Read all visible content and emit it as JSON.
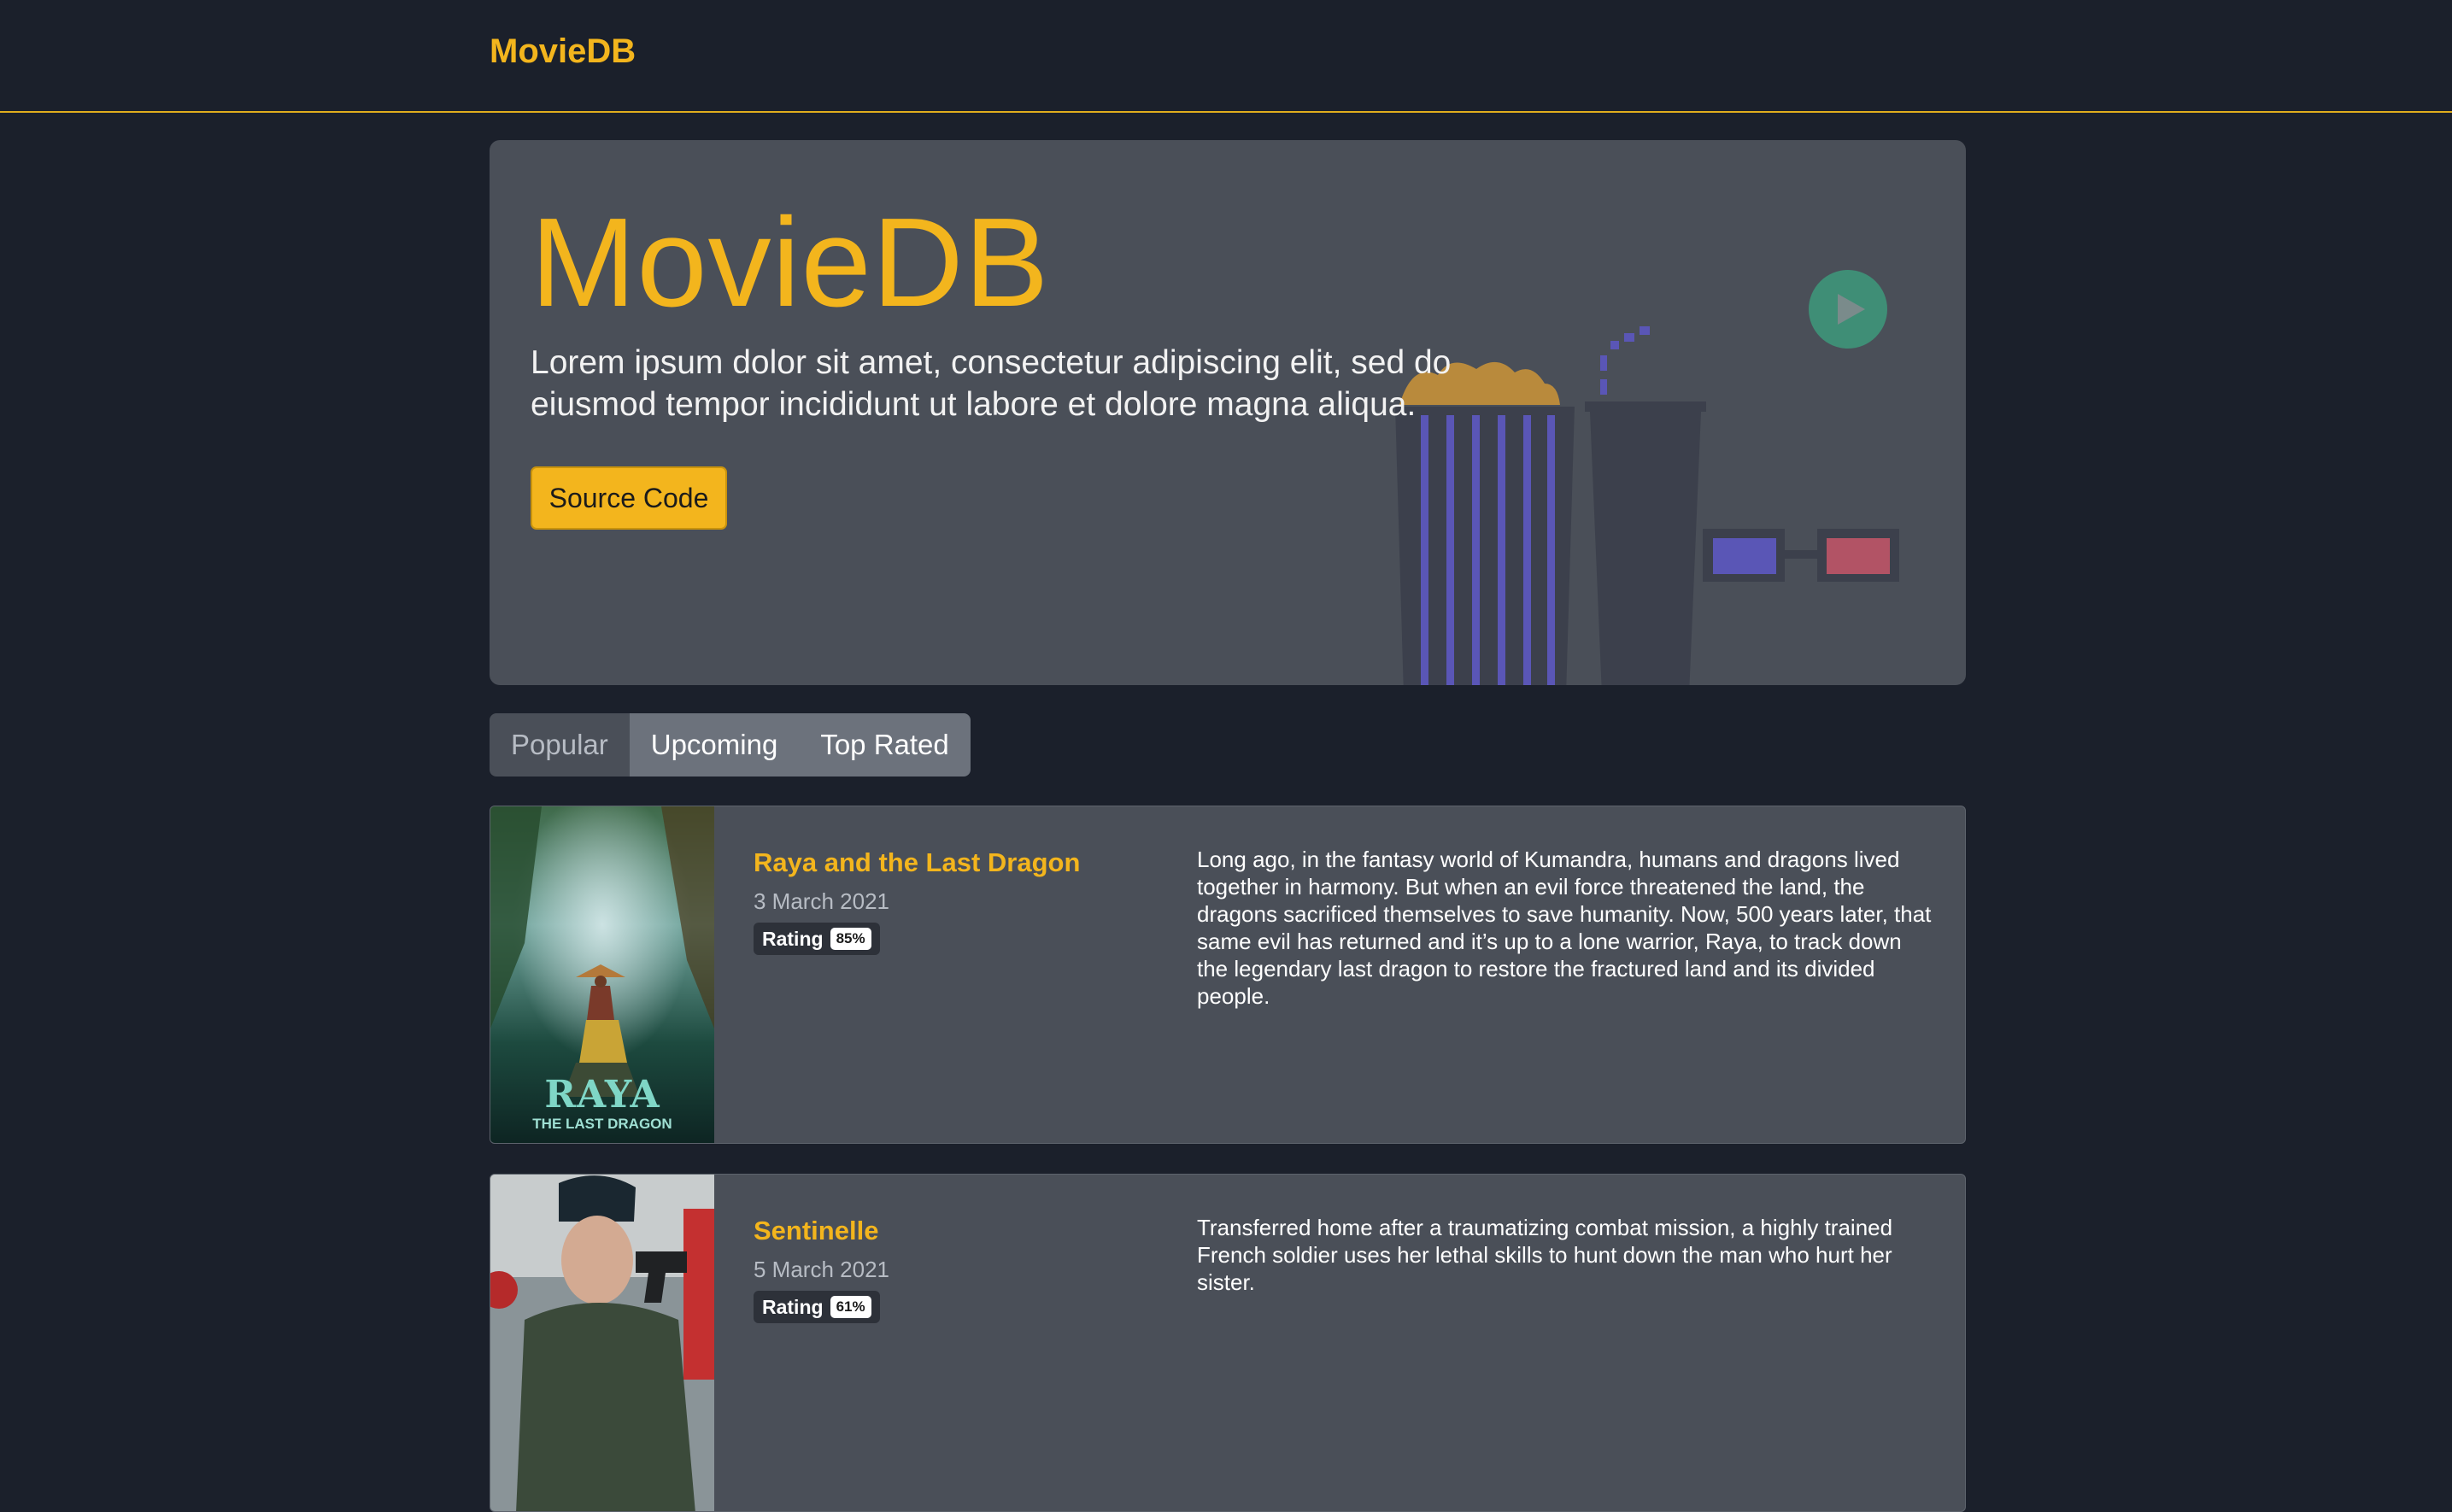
{
  "navbar": {
    "brand": "MovieDB"
  },
  "hero": {
    "title": "MovieDB",
    "description": "Lorem ipsum dolor sit amet, consectetur adipiscing elit, sed do eiusmod tempor incididunt ut labore et dolore magna aliqua.",
    "button_label": "Source Code"
  },
  "tabs": [
    {
      "label": "Popular",
      "active": true
    },
    {
      "label": "Upcoming",
      "active": false
    },
    {
      "label": "Top Rated",
      "active": false
    }
  ],
  "movies": [
    {
      "title": "Raya and the Last Dragon",
      "date": "3 March 2021",
      "rating_label": "Rating",
      "rating": "85%",
      "overview": "Long ago, in the fantasy world of Kumandra, humans and dragons lived together in harmony. But when an evil force threatened the land, the dragons sacrificed themselves to save humanity. Now, 500 years later, that same evil has returned and it’s up to a lone warrior, Raya, to track down the legendary last dragon to restore the fractured land and its divided people.",
      "poster_title": "RAYA",
      "poster_subtitle": "THE LAST DRAGON"
    },
    {
      "title": "Sentinelle",
      "date": "5 March 2021",
      "rating_label": "Rating",
      "rating": "61%",
      "overview": "Transferred home after a traumatizing combat mission, a highly trained French soldier uses her lethal skills to hunt down the man who hurt her sister."
    }
  ],
  "colors": {
    "background": "#1b202b",
    "accent": "#f3b51d",
    "panel": "#4a4f58"
  }
}
